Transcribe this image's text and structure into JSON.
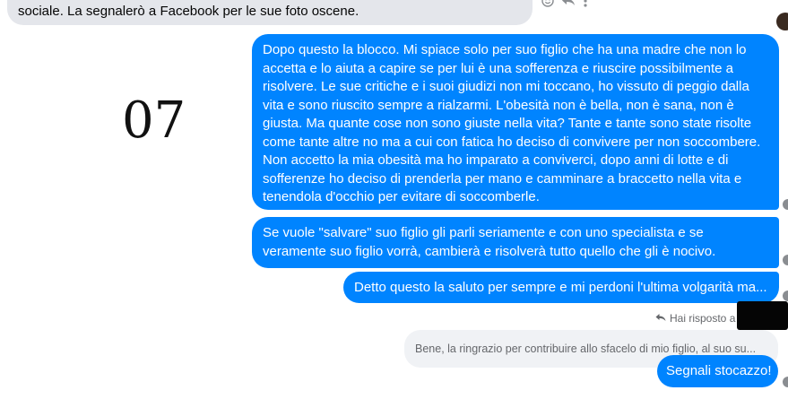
{
  "colors": {
    "outgoing_bubble": "#0084ff",
    "incoming_bubble": "#e4e6eb",
    "quoted_bubble": "#f0f2f5",
    "meta_text": "#65676b"
  },
  "incoming_top": {
    "text": "sociale. La segnalerò a Facebook per le sue foto oscene.",
    "actions": [
      "react-icon",
      "reply-icon",
      "more-icon"
    ]
  },
  "overlay_number": "07",
  "messages": [
    {
      "text": "Dopo questo la blocco. Mi spiace solo per suo figlio che ha una madre che non lo accetta e lo aiuta a capire se per lui è una sofferenza e riuscire possibilmente a risolvere. Le sue critiche e i suoi giudizi non mi toccano, ho vissuto di peggio dalla vita e sono riuscito sempre a rialzarmi. L'obesità non è bella, non è sana, non è giusta. Ma quante cose non sono giuste nella vita? Tante e tante sono state risolte come tante altre no ma a cui con fatica ho deciso di convivere per non soccombere. Non accetto la mia obesità ma ho imparato a conviverci, dopo anni di lotte e di sofferenze ho deciso di prenderla per mano e camminare a braccetto nella vita e tenendola d'occhio per evitare di soccomberle."
    },
    {
      "text": "Se vuole \"salvare\" suo figlio gli parli seriamente e con uno specialista e se veramente suo figlio vorrà, cambierà e risolverà tutto quello che gli è nocivo."
    },
    {
      "text": "Detto questo la saluto per sempre e mi perdoni l'ultima volgarità ma..."
    }
  ],
  "reply": {
    "indicator": "Hai risposto a",
    "quoted_text": "Bene, la ringrazio per contribuire allo sfacelo di mio figlio, al suo su...",
    "message": "Segnali stocazzo!"
  }
}
